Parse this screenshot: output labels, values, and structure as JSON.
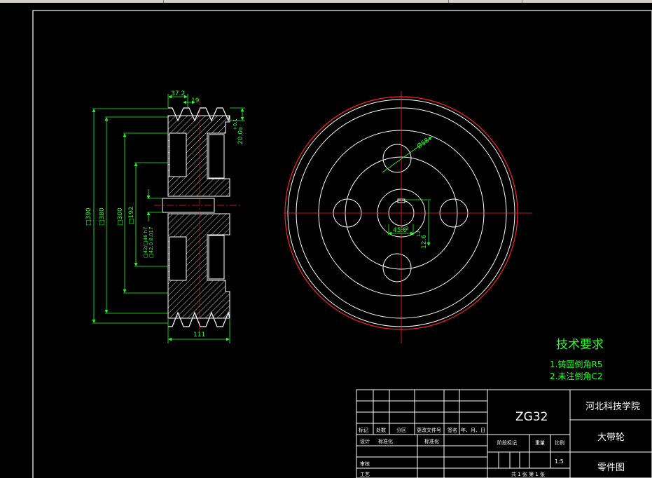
{
  "drawing": {
    "dims_side": {
      "groove_angle": "37.2",
      "groove_pitch": "19",
      "groove_depth": "20.0",
      "groove_depth_tol": "+0.1",
      "groove_depth_tol_low": "0",
      "overall_width": "111",
      "d_outer": "□390",
      "d_pitch": "□380",
      "d_rim": "□300",
      "d_hub": "□192",
      "bore_a": "□42/□46 h7",
      "bore_b": "□42.0 0.017"
    },
    "dims_front": {
      "hole_diameter": "Ø58",
      "keyway_width": "12",
      "keyway_tol": "0.3",
      "bore": "45.0",
      "keyway_depth": "12.6"
    },
    "notes": {
      "heading": "技术要求",
      "line1": "1.铸圆倒角R5",
      "line2": "2.未注倒角C2"
    },
    "title_block": {
      "drawing_no": "ZG32",
      "institution": "河北科技学院",
      "part_name": "大带轮",
      "drawing_type": "零件图",
      "scale": "1:5",
      "row_labels": [
        "标记",
        "处数",
        "分区",
        "更改文件号",
        "签名",
        "年、月、日"
      ],
      "design": "设计",
      "designer": "标准化",
      "standardize": "标准化",
      "stage_mark": "阶段标记",
      "weight": "重量",
      "ratio": "比例",
      "review": "审核",
      "process": "工艺",
      "sheet": "共 1 张 第 1 张"
    }
  },
  "colors": {
    "background": "#000000",
    "outline": "#ffffff",
    "center_line": "#ff2020",
    "dimension": "#22ff22",
    "hatch": "#ffffff"
  }
}
